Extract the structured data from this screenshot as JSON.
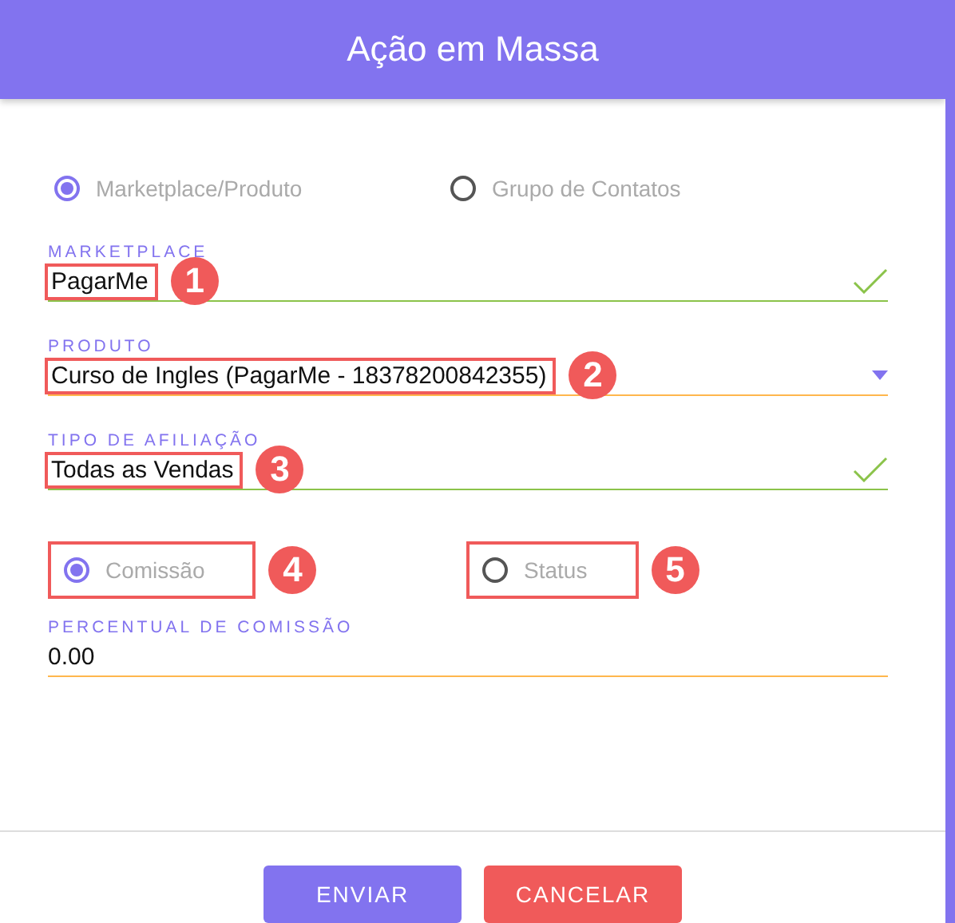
{
  "dialog": {
    "title": "Ação em Massa"
  },
  "source_options": [
    {
      "label": "Marketplace/Produto",
      "selected": true
    },
    {
      "label": "Grupo de Contatos",
      "selected": false
    }
  ],
  "fields": [
    {
      "label": "MARKETPLACE",
      "value": "PagarMe",
      "kind": "text",
      "valid": true,
      "callout": "1"
    },
    {
      "label": "PRODUTO",
      "value": "Curso de Ingles (PagarMe - 18378200842355)",
      "kind": "select",
      "valid": false,
      "callout": "2"
    },
    {
      "label": "TIPO DE AFILIAÇÃO",
      "value": "Todas as Vendas",
      "kind": "text",
      "valid": true,
      "callout": "3"
    }
  ],
  "mode_options": [
    {
      "label": "Comissão",
      "selected": true,
      "callout": "4"
    },
    {
      "label": "Status",
      "selected": false,
      "callout": "5"
    }
  ],
  "percent_field": {
    "label": "PERCENTUAL DE COMISSÃO",
    "value": "0.00",
    "valid": false
  },
  "buttons": [
    {
      "label": "ENVIAR",
      "kind": "primary"
    },
    {
      "label": "CANCELAR",
      "kind": "danger"
    }
  ]
}
